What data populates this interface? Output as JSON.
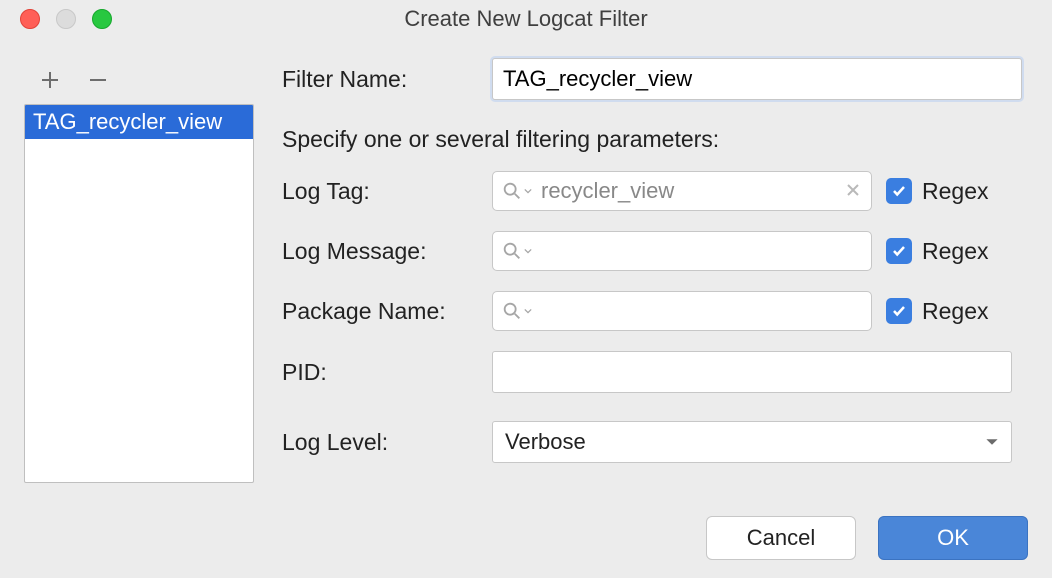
{
  "window": {
    "title": "Create New Logcat Filter"
  },
  "sidebar": {
    "items": [
      {
        "label": "TAG_recycler_view",
        "selected": true
      }
    ]
  },
  "form": {
    "filter_name_label": "Filter Name:",
    "filter_name_value": "TAG_recycler_view",
    "section_label": "Specify one or several filtering parameters:",
    "log_tag_label": "Log Tag:",
    "log_tag_value": "recycler_view",
    "log_message_label": "Log Message:",
    "log_message_value": "",
    "package_name_label": "Package Name:",
    "package_name_value": "",
    "pid_label": "PID:",
    "pid_value": "",
    "log_level_label": "Log Level:",
    "log_level_value": "Verbose",
    "regex_label": "Regex",
    "regex_log_tag": true,
    "regex_log_message": true,
    "regex_package_name": true
  },
  "footer": {
    "cancel_label": "Cancel",
    "ok_label": "OK"
  },
  "colors": {
    "accent": "#4a86d8",
    "selection": "#2a6bd8"
  }
}
